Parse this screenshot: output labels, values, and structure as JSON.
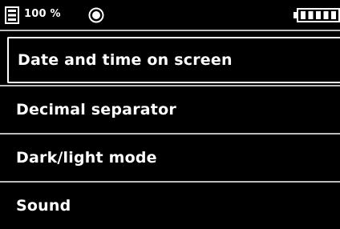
{
  "status": {
    "storage_percent": "100 %",
    "storage_icon": "storage-icon",
    "record_icon": "record-icon",
    "battery_icon": "battery-icon",
    "battery_level": 1.0
  },
  "menu": {
    "selected_index": 0,
    "items": [
      {
        "label": "Date and time on screen"
      },
      {
        "label": "Decimal separator"
      },
      {
        "label": "Dark/light mode"
      },
      {
        "label": "Sound"
      }
    ]
  },
  "colors": {
    "background": "#000000",
    "text": "#ffffff",
    "divider": "#bdbdbd"
  }
}
